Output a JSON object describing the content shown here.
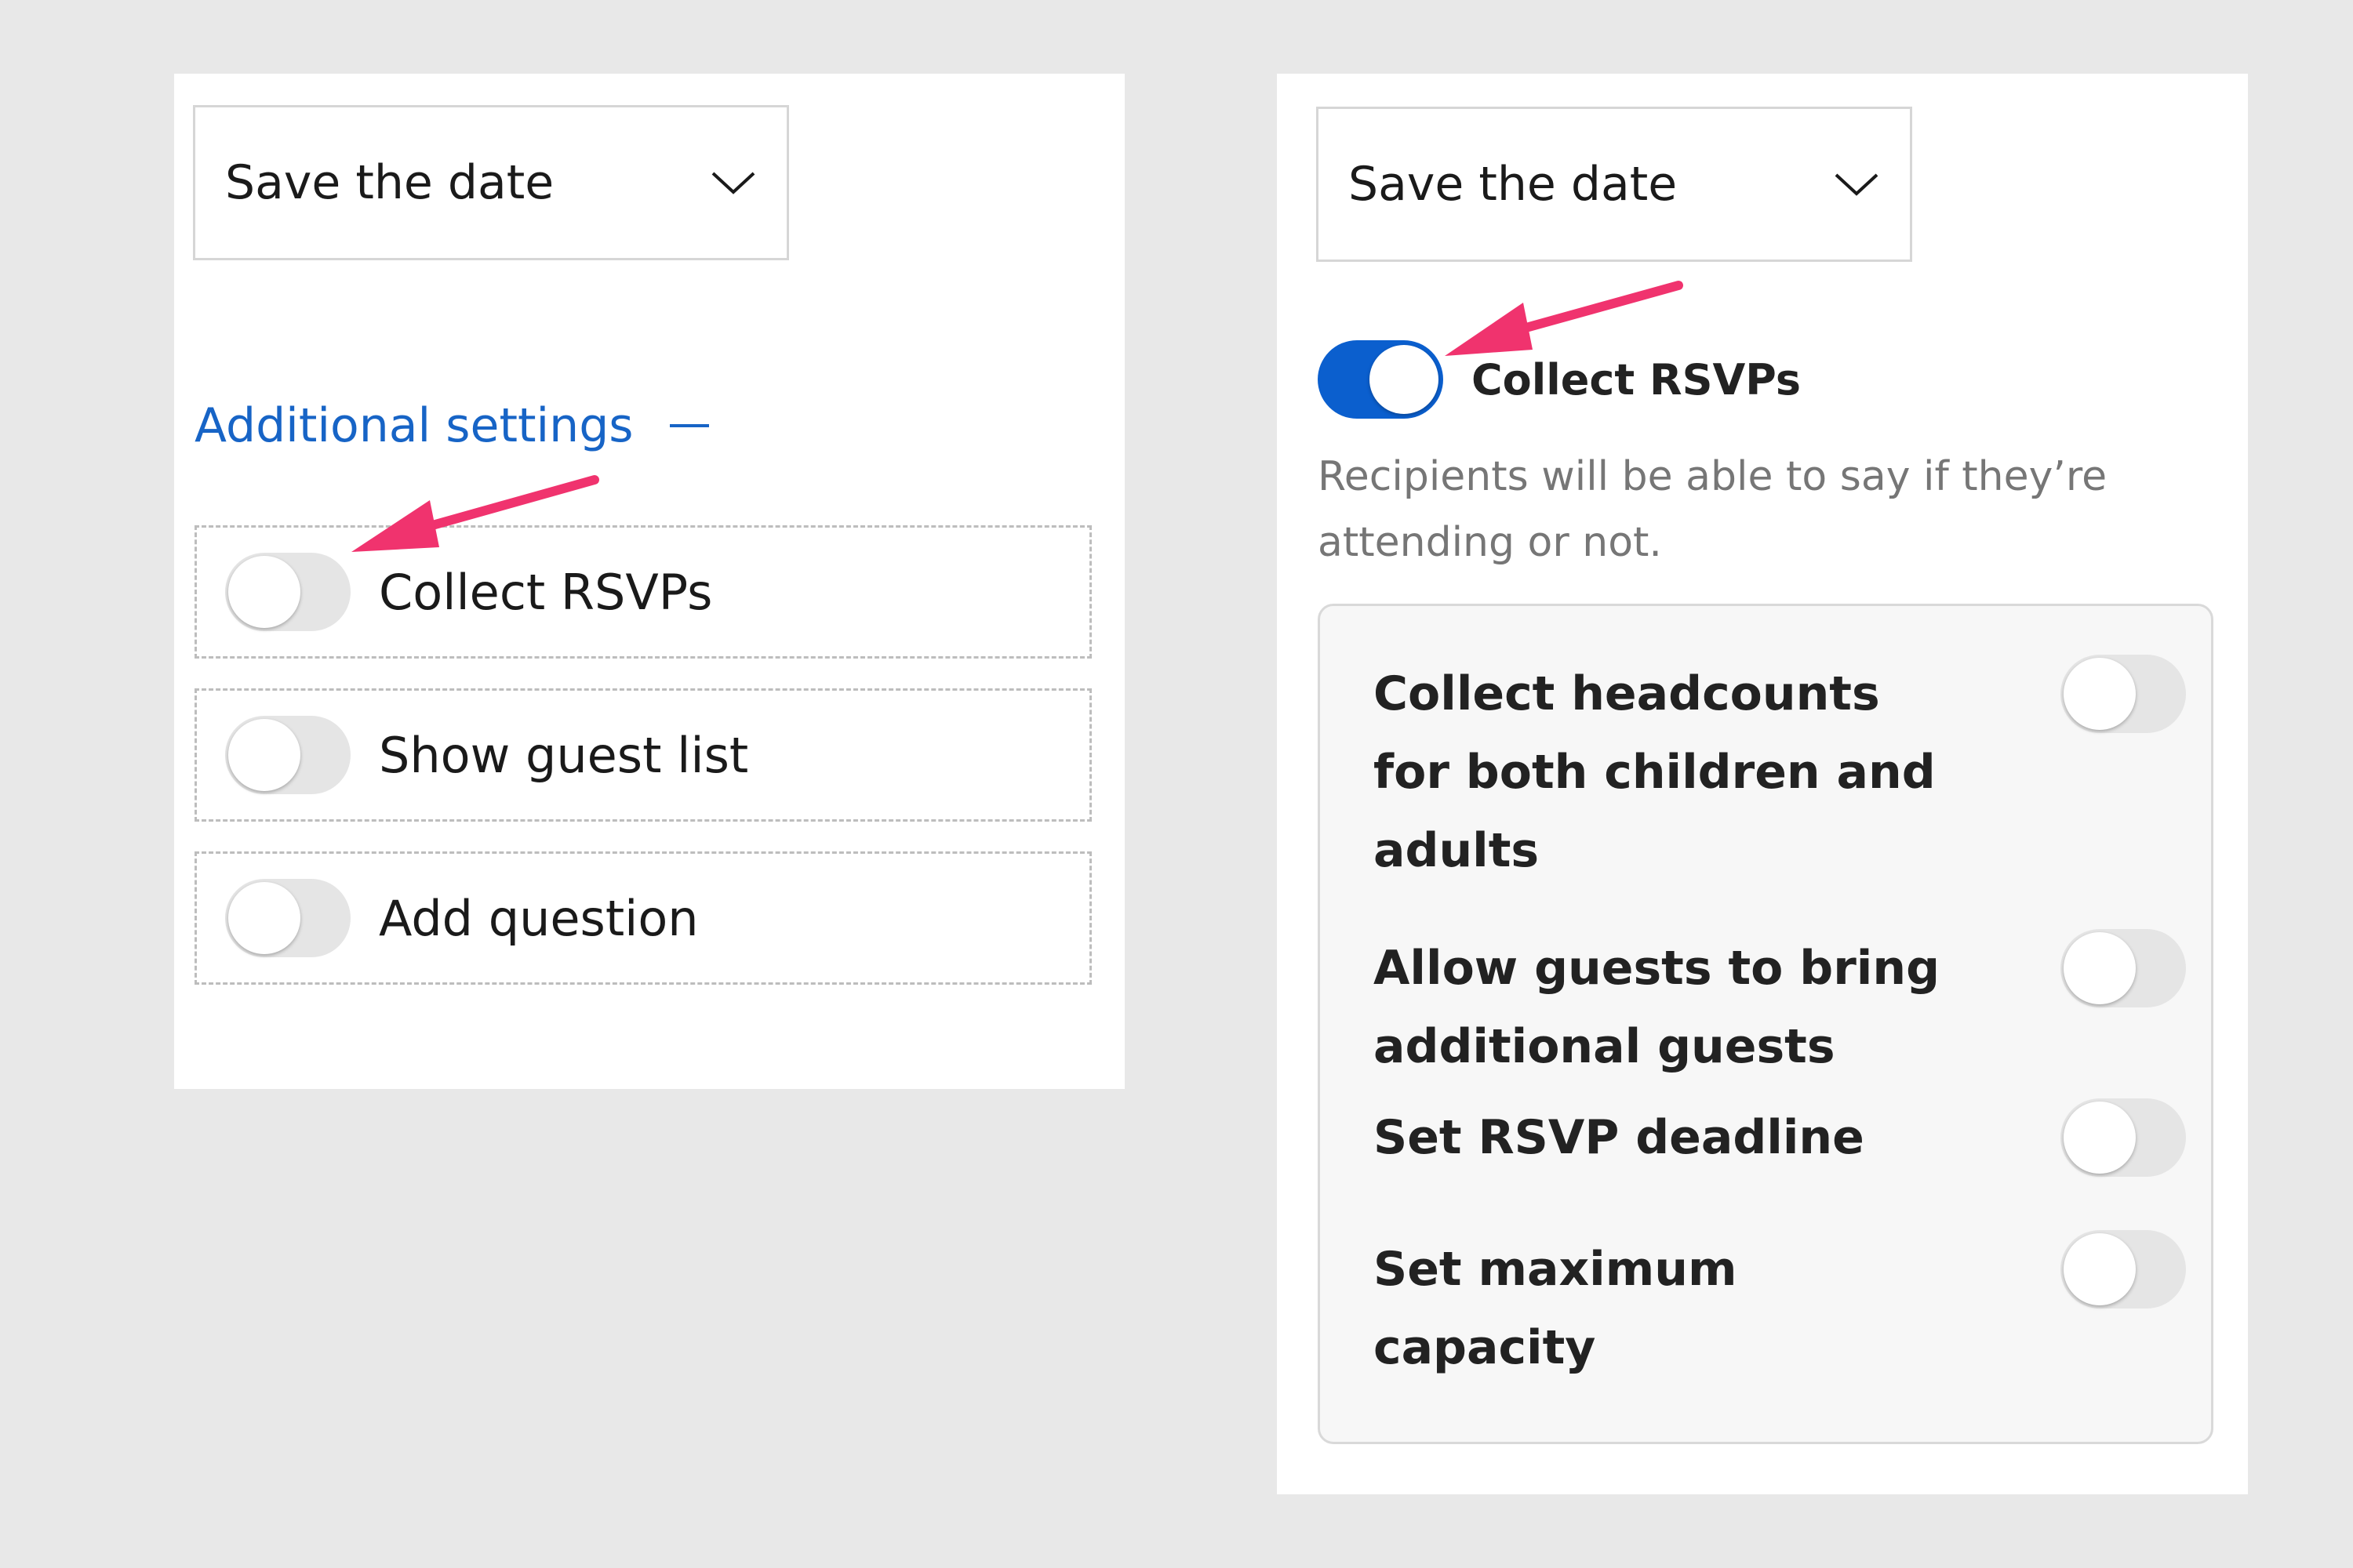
{
  "left_panel": {
    "select": {
      "value": "Save the date",
      "icon": "chevron-down-icon"
    },
    "additional_settings": {
      "label": "Additional settings",
      "icon": "collapse-dash-icon"
    },
    "options": [
      {
        "label": "Collect RSVPs",
        "enabled": false
      },
      {
        "label": "Show guest list",
        "enabled": false
      },
      {
        "label": "Add question",
        "enabled": false
      }
    ]
  },
  "right_panel": {
    "select": {
      "value": "Save the date",
      "icon": "chevron-down-icon"
    },
    "collect_rsvps": {
      "label": "Collect RSVPs",
      "enabled": true
    },
    "description": "Recipients will be able to say if they’re attending or not.",
    "sub_options": [
      {
        "label": "Collect headcounts for both children and adults",
        "enabled": false
      },
      {
        "label": "Allow guests to bring additional guests",
        "enabled": false
      },
      {
        "label": "Set RSVP deadline",
        "enabled": false
      },
      {
        "label": "Set maximum capacity",
        "enabled": false
      }
    ]
  },
  "colors": {
    "accent": "#1764c6",
    "toggle_on": "#0b5fce",
    "annotation_arrow": "#f0336e"
  }
}
